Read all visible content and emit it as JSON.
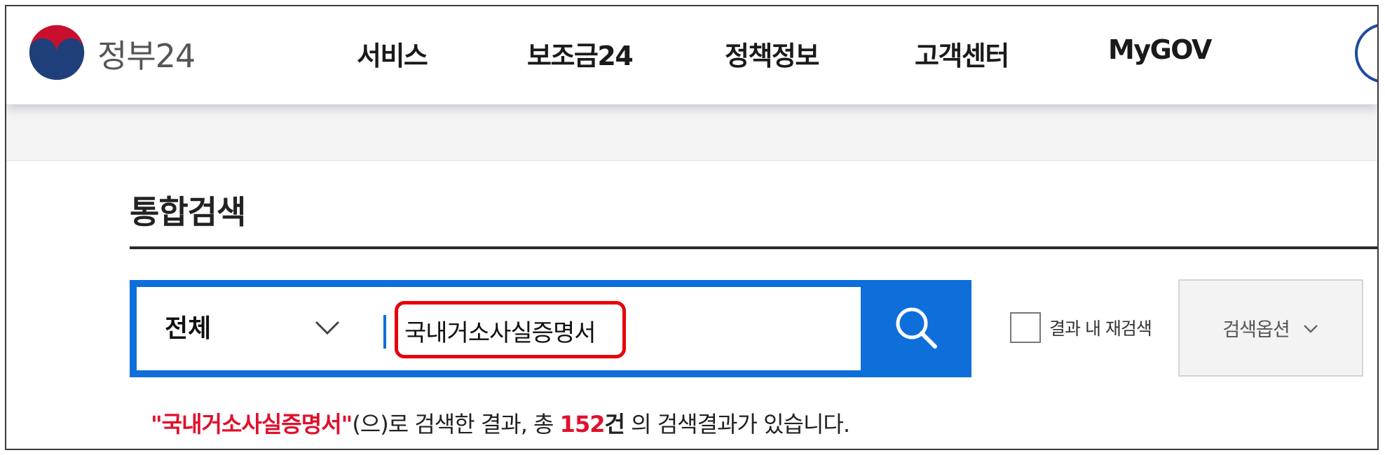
{
  "header": {
    "logo_text": "정부24",
    "nav": [
      "서비스",
      "보조금24",
      "정책정보",
      "고객센터",
      "MyGOV"
    ]
  },
  "main": {
    "title": "통합검색"
  },
  "search": {
    "scope": "전체",
    "query": "국내거소사실증명서",
    "recheck_label": "결과 내 재검색",
    "options_label": "검색옵션"
  },
  "result": {
    "quoted_term": "\"국내거소사실증명서\"",
    "text_before_count": "(으)로 검색한 결과, 총 ",
    "count": "152",
    "count_unit": "건",
    "text_after": " 의 검색결과가 있습니다."
  },
  "colors": {
    "accent_blue": "#0e6fdb",
    "highlight_red": "#e0102d",
    "logo_blue": "#1f3f7a",
    "logo_red": "#c8102e"
  },
  "icons": {
    "logo": "government-emblem-icon",
    "scope_dropdown": "chevron-down-icon",
    "search": "search-icon",
    "options": "chevron-down-icon"
  }
}
